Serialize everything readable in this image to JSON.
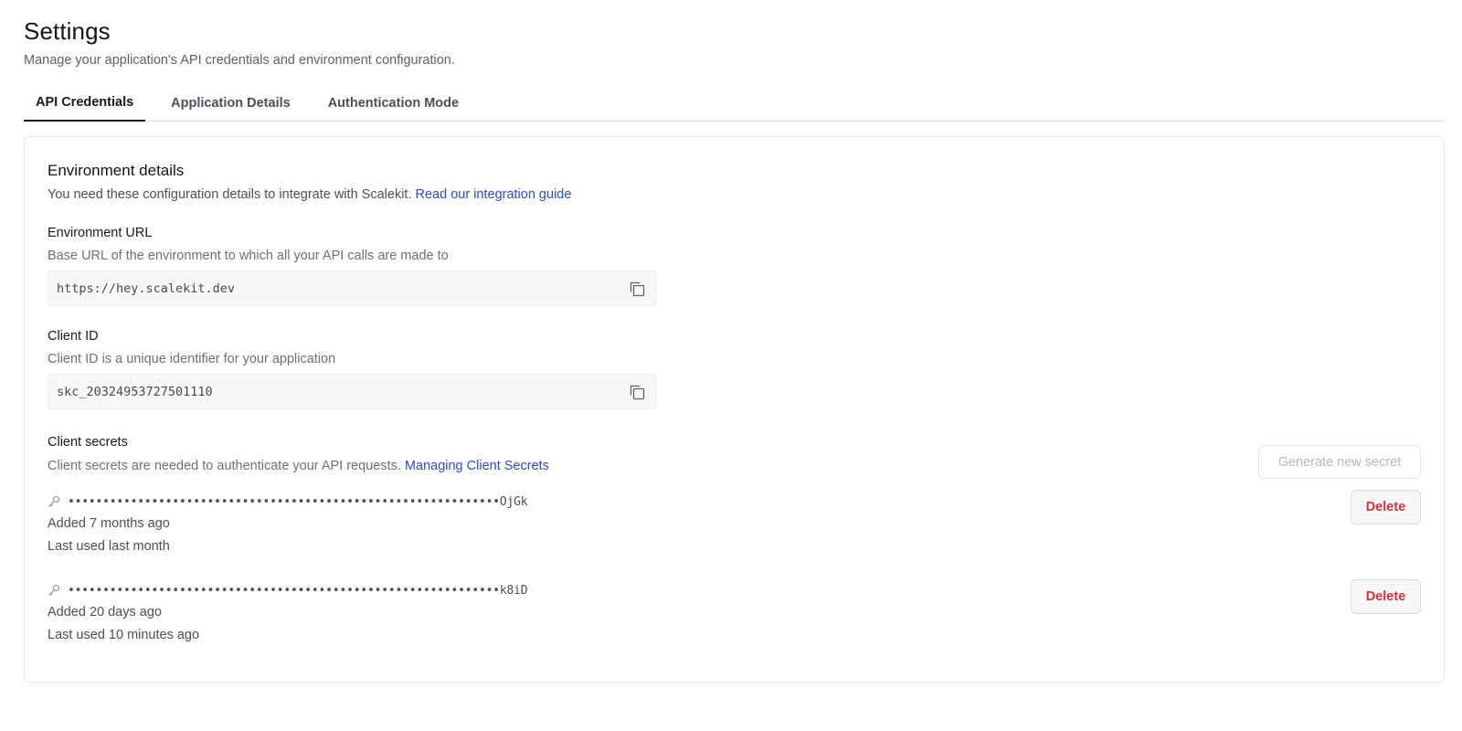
{
  "page": {
    "title": "Settings",
    "subtitle": "Manage your application's API credentials and environment configuration."
  },
  "tabs": [
    {
      "label": "API Credentials",
      "active": true
    },
    {
      "label": "Application Details",
      "active": false
    },
    {
      "label": "Authentication Mode",
      "active": false
    }
  ],
  "environment": {
    "title": "Environment details",
    "description": "You need these configuration details to integrate with Scalekit.",
    "guide_link": "Read our integration guide",
    "url_field": {
      "label": "Environment URL",
      "help": "Base URL of the environment to which all your API calls are made to",
      "value": "https://hey.scalekit.dev"
    },
    "client_id_field": {
      "label": "Client ID",
      "help": "Client ID is a unique identifier for your application",
      "value": "skc_20324953727501110"
    }
  },
  "client_secrets": {
    "label": "Client secrets",
    "description": "Client secrets are needed to authenticate your API requests.",
    "docs_link": "Managing Client Secrets",
    "generate_label": "Generate new secret",
    "items": [
      {
        "masked": "••••••••••••••••••••••••••••••••••••••••••••••••••••••••••••••OjGk",
        "added": "Added 7 months ago",
        "last_used": "Last used last month",
        "delete_label": "Delete"
      },
      {
        "masked": "••••••••••••••••••••••••••••••••••••••••••••••••••••••••••••••k8iD",
        "added": "Added 20 days ago",
        "last_used": "Last used 10 minutes ago",
        "delete_label": "Delete"
      }
    ]
  },
  "colors": {
    "link": "#2b4dc7",
    "danger": "#d6333f",
    "field_bg": "#f7f7f8",
    "border": "#e6e8eb"
  }
}
